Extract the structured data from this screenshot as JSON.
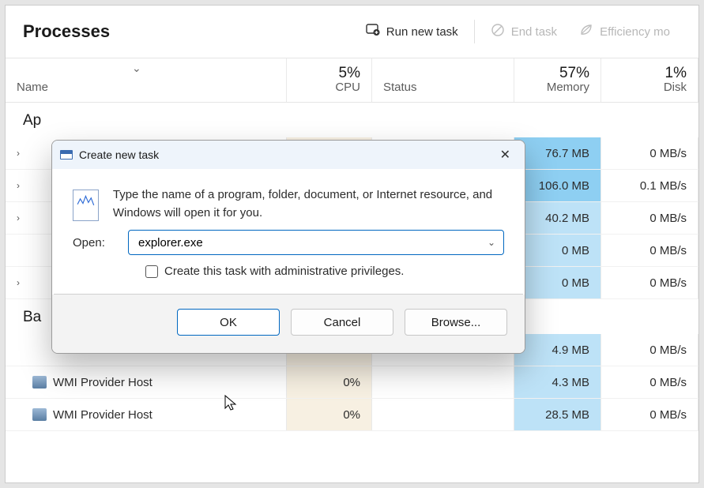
{
  "header": {
    "title": "Processes",
    "run_new_task": "Run new task",
    "end_task": "End task",
    "efficiency": "Efficiency mo"
  },
  "columns": {
    "name": "Name",
    "cpu_pct": "5%",
    "cpu": "CPU",
    "status": "Status",
    "mem_pct": "57%",
    "memory": "Memory",
    "disk_pct": "1%",
    "disk": "Disk"
  },
  "sections": {
    "apps": "Ap",
    "background": "Ba"
  },
  "apps": [
    {
      "cpu": "",
      "mem": "76.7 MB",
      "disk": "0 MB/s",
      "mem_shade": "heavy"
    },
    {
      "cpu": "",
      "mem": "106.0 MB",
      "disk": "0.1 MB/s",
      "mem_shade": "heavy"
    },
    {
      "cpu": "",
      "mem": "40.2 MB",
      "disk": "0 MB/s",
      "mem_shade": "light"
    },
    {
      "cpu": "",
      "mem": "0 MB",
      "disk": "0 MB/s",
      "mem_shade": "light"
    },
    {
      "cpu": "",
      "mem": "0 MB",
      "disk": "0 MB/s",
      "mem_shade": "light"
    }
  ],
  "background": [
    {
      "name": "",
      "cpu": "",
      "mem": "4.9 MB",
      "disk": "0 MB/s"
    },
    {
      "name": "WMI Provider Host",
      "cpu": "0%",
      "mem": "4.3 MB",
      "disk": "0 MB/s"
    },
    {
      "name": "WMI Provider Host",
      "cpu": "0%",
      "mem": "28.5 MB",
      "disk": "0 MB/s"
    }
  ],
  "modal": {
    "title": "Create new task",
    "desc": "Type the name of a program, folder, document, or Internet resource, and Windows will open it for you.",
    "open_label": "Open:",
    "value": "explorer.exe",
    "admin": "Create this task with administrative privileges.",
    "ok": "OK",
    "cancel": "Cancel",
    "browse": "Browse..."
  }
}
